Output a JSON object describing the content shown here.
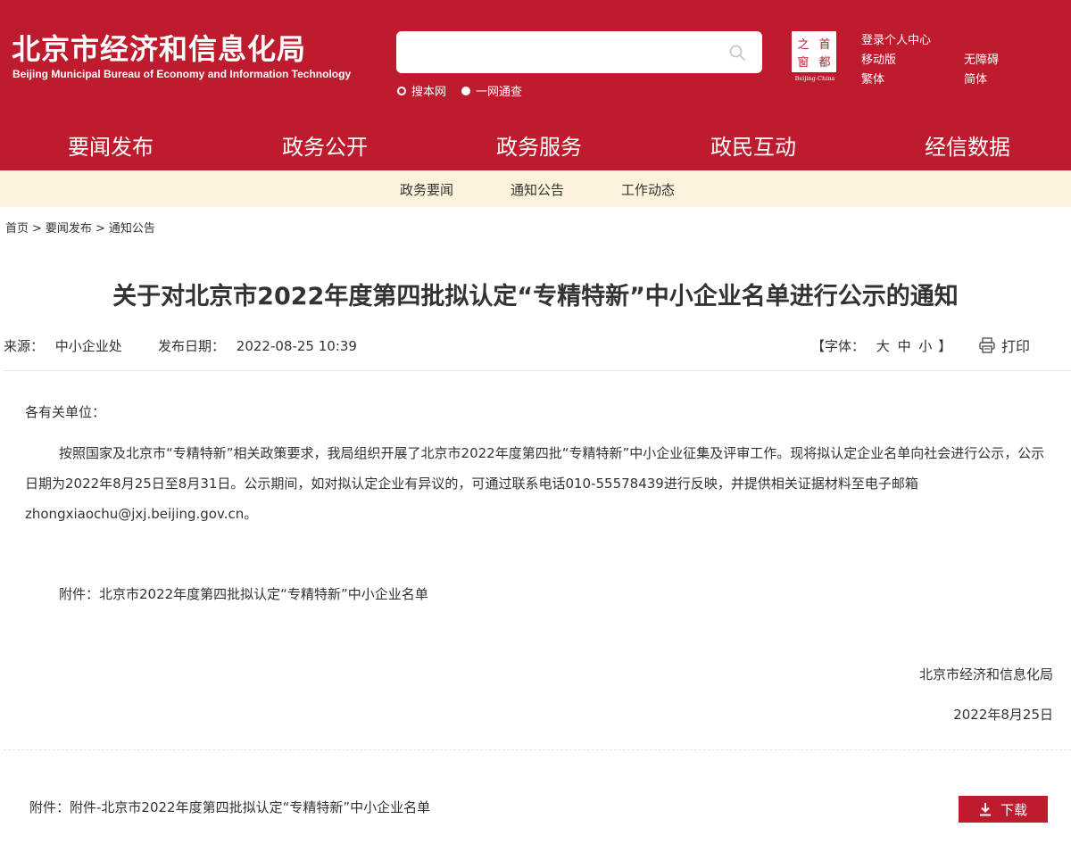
{
  "header": {
    "title_cn": "北京市经济和信息化局",
    "title_en": "Beijing Municipal Bureau of Economy and Information Technology",
    "search": {
      "placeholder": "",
      "scope_options": [
        "搜本网",
        "一网通查"
      ],
      "selected_scope": "一网通查"
    },
    "logo": {
      "chars": [
        "之",
        "首",
        "都",
        "窗"
      ],
      "caption": "Beijing-China"
    },
    "top_links": [
      "登录个人中心",
      "移动版",
      "无障碍",
      "繁体",
      "简体"
    ]
  },
  "main_nav": [
    "要闻发布",
    "政务公开",
    "政务服务",
    "政民互动",
    "经信数据"
  ],
  "main_nav_active": "要闻发布",
  "sub_nav": [
    "政务要闻",
    "通知公告",
    "工作动态"
  ],
  "breadcrumb": [
    "首页",
    "要闻发布",
    "通知公告"
  ],
  "breadcrumb_sep": ">",
  "article": {
    "title": "关于对北京市2022年度第四批拟认定“专精特新”中小企业名单进行公示的通知",
    "source_label": "来源：",
    "source": "中小企业处",
    "date_label": "发布日期：",
    "date": "2022-08-25 10:39",
    "font_label_open": "【字体：",
    "font_sizes": [
      "大",
      "中",
      "小"
    ],
    "font_label_close": "】",
    "print_label": "打印",
    "salutation": "各有关单位：",
    "paragraph": "按照国家及北京市“专精特新”相关政策要求，我局组织开展了北京市2022年度第四批“专精特新”中小企业征集及评审工作。现将拟认定企业名单向社会进行公示，公示日期为2022年8月25日至8月31日。公示期间，如对拟认定企业有异议的，可通过联系电话010-55578439进行反映，并提供相关证据材料至电子邮箱zhongxiaochu@jxj.beijing.gov.cn。",
    "attachment_line": "附件：北京市2022年度第四批拟认定“专精特新”中小企业名单",
    "signature": "北京市经济和信息化局",
    "sign_date": "2022年8月25日"
  },
  "attachment_bar": {
    "label": "附件：附件-北京市2022年度第四批拟认定“专精特新”中小企业名单",
    "download_label": "下载"
  },
  "colors": {
    "brand_red": "#be1c2e",
    "subnav_bg": "#fdf3dc",
    "text": "#333333"
  }
}
